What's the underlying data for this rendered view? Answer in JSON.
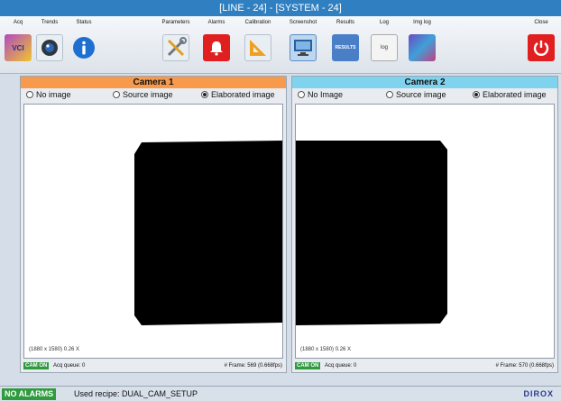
{
  "window": {
    "title": "[LINE - 24] - [SYSTEM - 24]"
  },
  "toolbar": {
    "acq": "Acq",
    "trends": "Trends",
    "status": "Status",
    "parameters": "Parameters",
    "alarms": "Alarms",
    "calibration": "Calibration",
    "screenshot": "Screenshot",
    "results": "Results",
    "results_icon_text": "RESULTS",
    "log": "Log",
    "log_icon_text": "log",
    "img_log": "Img log",
    "close": "Close",
    "acq_icon_text": "VCI"
  },
  "cameras": [
    {
      "title": "Camera 1",
      "header_color": "#f79a4c",
      "opt_no": "No image",
      "opt_source": "Source image",
      "opt_elab": "Elaborated image",
      "selected": "Elaborated image",
      "resolution": "(1880 x 1580)   0.26 X",
      "cam_on": "CAM ON",
      "acq_queue": "Acq queue: 0",
      "frames": "# Frame: 569 (0.668fps)"
    },
    {
      "title": "Camera 2",
      "header_color": "#7fd3ee",
      "opt_no": "No Image",
      "opt_source": "Source image",
      "opt_elab": "Elaborated image",
      "selected": "Elaborated image",
      "resolution": "(1880 x 1580)   0.26 X",
      "cam_on": "CAM ON",
      "acq_queue": "Acq queue: 0",
      "frames": "# Frame: 570 (0.668fps)"
    }
  ],
  "status": {
    "alarms": "NO ALARMS",
    "recipe": "Used recipe: DUAL_CAM_SETUP",
    "logo": "DIROX"
  },
  "colors": {
    "accent": "#2f7fc1",
    "ok": "#2f9a3e"
  }
}
